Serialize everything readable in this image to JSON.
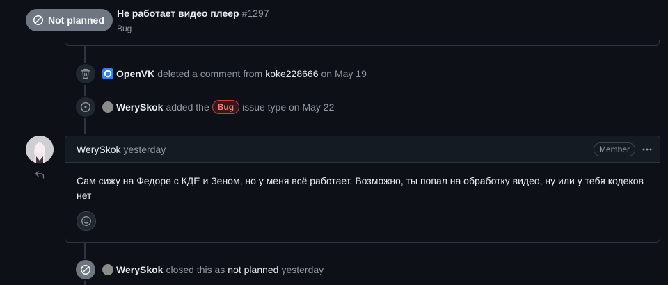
{
  "header": {
    "state_label": "Not planned",
    "title": "Не работает видео плеер",
    "number": "#1297",
    "issue_type": "Bug"
  },
  "events": {
    "deleted": {
      "actor": "OpenVK",
      "text": "deleted a comment from",
      "target": "koke228666",
      "date": "on May 19"
    },
    "typed": {
      "actor": "WerySkok",
      "text_before": "added the",
      "label": "Bug",
      "text_after": "issue type on May 22"
    },
    "closed": {
      "actor": "WerySkok",
      "text_before": "closed this as",
      "reason": "not planned",
      "date": "yesterday"
    }
  },
  "comment": {
    "author": "WerySkok",
    "time": "yesterday",
    "role_badge": "Member",
    "body": "Сам сижу на Федоре с КДЕ и Зеном, но у меня всё работает. Возможно, ты попал на обработку видео, ну или у тебя кодеков нет"
  },
  "colors": {
    "background": "#0d1117",
    "border": "#30363d",
    "muted_text": "#9198a1",
    "label_bug": "#ff7b72",
    "state_closed": "#6e7681"
  },
  "icons": {
    "state": "skip-icon",
    "deleted": "trash-icon",
    "typed": "issue-opened-icon",
    "closed": "skip-icon",
    "reply": "reply-icon",
    "menu": "kebab-horizontal-icon",
    "reaction": "smiley-icon"
  }
}
